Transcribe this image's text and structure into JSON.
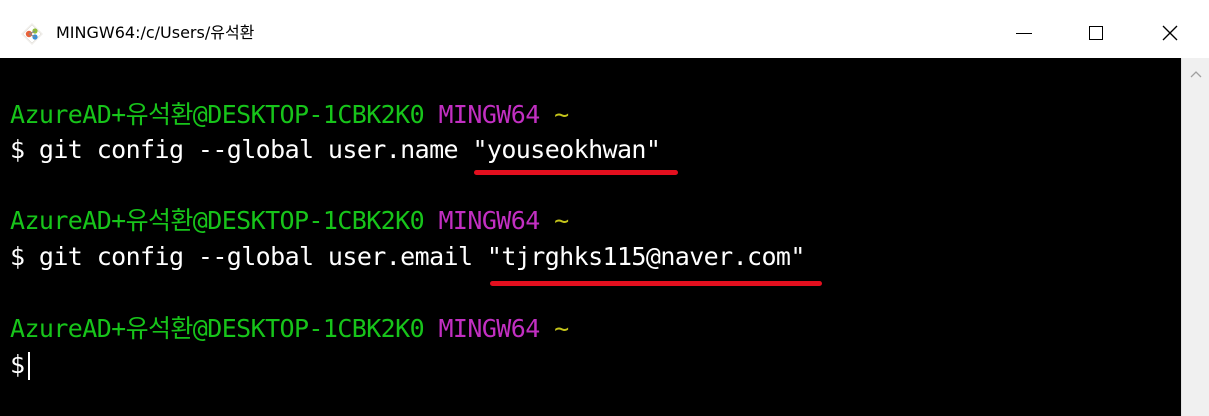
{
  "window": {
    "title": "MINGW64:/c/Users/유석환",
    "icon": "git-diamond-icon",
    "controls": {
      "minimize": "minimize-icon",
      "maximize": "maximize-icon",
      "close": "close-icon"
    }
  },
  "terminal": {
    "colors": {
      "background": "#000000",
      "user_host": "#17c41a",
      "env": "#c22fc2",
      "path": "#c4c41a",
      "text": "#ffffff",
      "highlight_underline": "#e30f1e"
    },
    "blocks": [
      {
        "prompt_user": "AzureAD+유석환@DESKTOP-1CBK2K0",
        "prompt_env": "MINGW64",
        "prompt_path": "~",
        "command_prefix": "$ git config --global user.name ",
        "command_arg": "\"youseokhwan\""
      },
      {
        "prompt_user": "AzureAD+유석환@DESKTOP-1CBK2K0",
        "prompt_env": "MINGW64",
        "prompt_path": "~",
        "command_prefix": "$ git config --global user.email ",
        "command_arg": "\"tjrghks115@naver.com\""
      },
      {
        "prompt_user": "AzureAD+유석환@DESKTOP-1CBK2K0",
        "prompt_env": "MINGW64",
        "prompt_path": "~",
        "command_prefix": "$",
        "command_arg": ""
      }
    ]
  }
}
